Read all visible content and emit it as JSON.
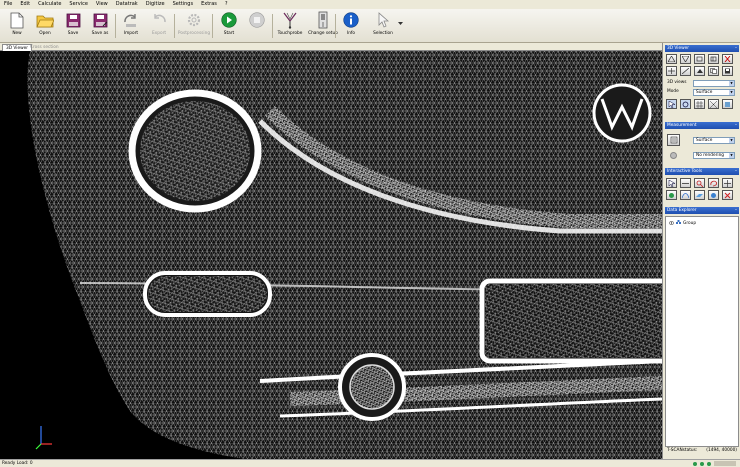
{
  "menu": [
    "File",
    "Edit",
    "Calculate",
    "Service",
    "View",
    "Datatrak",
    "Digitize",
    "Settings",
    "Extras",
    "?"
  ],
  "toolbar": [
    {
      "label": "New",
      "icon": "new-document-icon",
      "enabled": true
    },
    {
      "label": "Open",
      "icon": "open-folder-icon",
      "enabled": true
    },
    {
      "label": "Save",
      "icon": "save-icon",
      "enabled": true
    },
    {
      "label": "Save as",
      "icon": "save-as-icon",
      "enabled": true
    },
    {
      "label": "Import",
      "icon": "import-icon",
      "enabled": true
    },
    {
      "label": "Export",
      "icon": "export-icon",
      "enabled": false
    },
    {
      "label": "Postprocessing",
      "icon": "gear-icon",
      "enabled": false
    },
    {
      "label": "Start",
      "icon": "play-icon",
      "enabled": true
    },
    {
      "label": "",
      "icon": "stop-icon",
      "enabled": false
    },
    {
      "label": "Touchprobe",
      "icon": "touchprobe-icon",
      "enabled": true
    },
    {
      "label": "Change setup",
      "icon": "change-setup-icon",
      "enabled": true
    },
    {
      "label": "Info",
      "icon": "info-icon",
      "enabled": true
    },
    {
      "label": "Selection",
      "icon": "selection-cursor-icon",
      "enabled": true
    }
  ],
  "tabs": {
    "active": "3D Viewer",
    "inactive": "Cross section"
  },
  "panel": {
    "viewer_title": "3D Viewer",
    "views_label": "3D views",
    "mode_label": "Mode",
    "mode_value": "Surface",
    "measurement_title": "Measurement",
    "measurement_value": "Surface",
    "quality_value": "No rendering",
    "tools_title": "Interactive Tools",
    "explorer_title": "Data Explorer",
    "explorer_item": "Group",
    "status_label": "T-SCANstatus:",
    "status_value": "(1494, 40000)"
  },
  "status": {
    "left": "Ready  Load: 0"
  },
  "colors": {
    "accent": "#1f4fb0",
    "mesh": "#ffffff",
    "background": "#000000"
  }
}
